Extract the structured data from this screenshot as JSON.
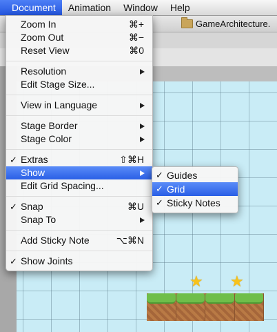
{
  "menubar": {
    "items": [
      "Document",
      "Animation",
      "Window",
      "Help"
    ]
  },
  "window": {
    "folder_label": "GameArchitecture."
  },
  "document_menu": {
    "zoom_in": {
      "label": "Zoom In",
      "shortcut": "⌘+"
    },
    "zoom_out": {
      "label": "Zoom Out",
      "shortcut": "⌘−"
    },
    "reset_view": {
      "label": "Reset View",
      "shortcut": "⌘0"
    },
    "resolution": {
      "label": "Resolution"
    },
    "edit_stage_size": {
      "label": "Edit Stage Size..."
    },
    "view_in_language": {
      "label": "View in Language"
    },
    "stage_border": {
      "label": "Stage Border"
    },
    "stage_color": {
      "label": "Stage Color"
    },
    "extras": {
      "label": "Extras",
      "shortcut": "⇧⌘H",
      "checked": true
    },
    "show": {
      "label": "Show",
      "highlighted": true
    },
    "edit_grid_spacing": {
      "label": "Edit Grid Spacing..."
    },
    "snap": {
      "label": "Snap",
      "shortcut": "⌘U",
      "checked": true
    },
    "snap_to": {
      "label": "Snap To"
    },
    "add_sticky_note": {
      "label": "Add Sticky Note",
      "shortcut": "⌥⌘N"
    },
    "show_joints": {
      "label": "Show Joints",
      "checked": true
    }
  },
  "show_submenu": {
    "guides": {
      "label": "Guides",
      "checked": true
    },
    "grid": {
      "label": "Grid",
      "checked": true,
      "highlighted": true
    },
    "sticky_notes": {
      "label": "Sticky Notes",
      "checked": true
    }
  },
  "check_glyph": "✓",
  "colors": {
    "menu_highlight": "#2a5fe6",
    "stage": "#c9ecf6"
  }
}
